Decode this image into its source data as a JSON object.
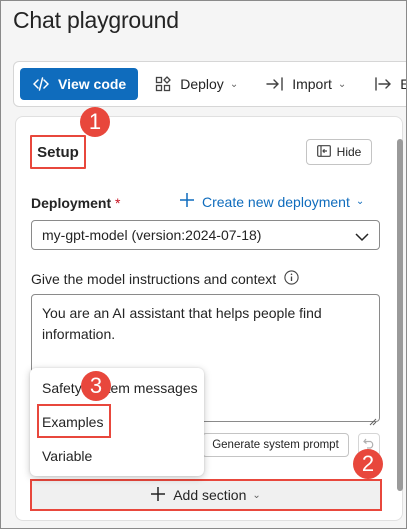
{
  "page": {
    "title": "Chat playground"
  },
  "toolbar": {
    "view_code": "View code",
    "deploy": "Deploy",
    "import": "Import",
    "export_partial": "E"
  },
  "setup": {
    "title": "Setup",
    "hide_label": "Hide",
    "deployment_label": "Deployment",
    "required_mark": "*",
    "create_new_label": "Create new deployment",
    "deployment_value": "my-gpt-model (version:2024-07-18)",
    "instructions_label": "Give the model instructions and context",
    "instructions_value": "You are an AI assistant that helps people find information.",
    "generate_label": "Generate system prompt",
    "add_section_label": "Add section"
  },
  "menu": {
    "items": [
      {
        "label": "Safety system messages"
      },
      {
        "label": "Examples"
      },
      {
        "label": "Variable"
      }
    ]
  },
  "callouts": [
    "1",
    "2",
    "3"
  ],
  "colors": {
    "accent": "#0f6cbd",
    "callout": "#e8473c",
    "required": "#c50f1f"
  }
}
